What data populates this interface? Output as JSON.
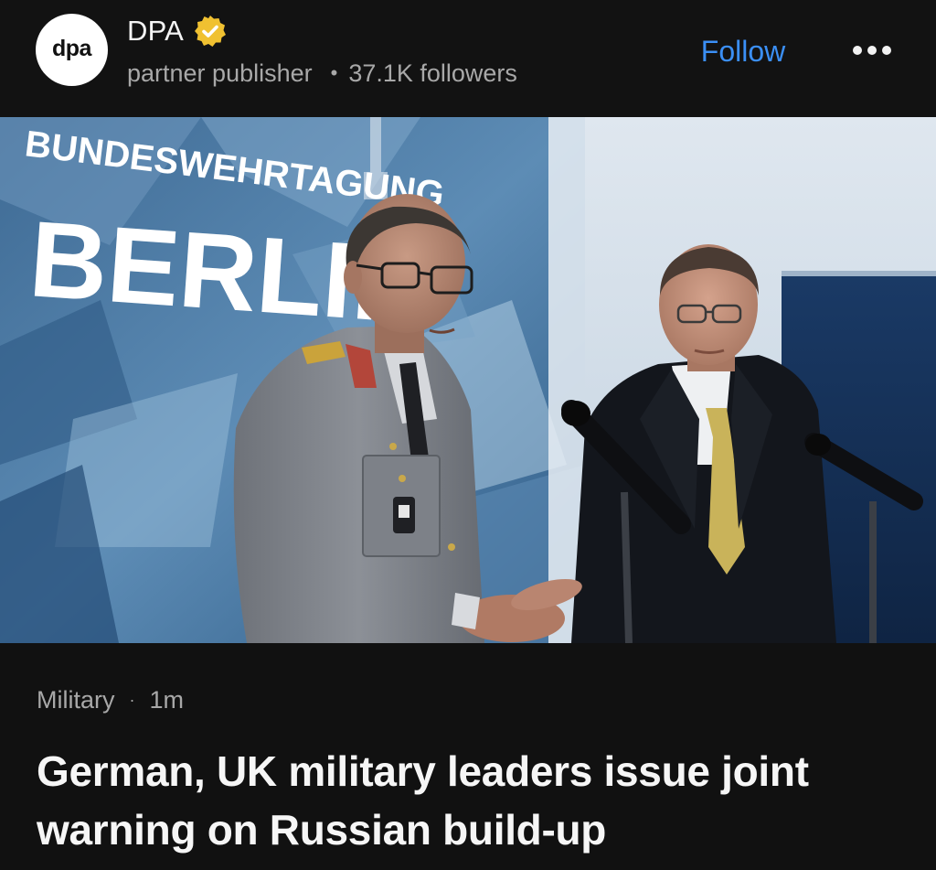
{
  "publisher": {
    "avatar_text": "dpa",
    "name": "DPA",
    "type_label": "partner publisher",
    "followers": "37.1K followers",
    "follow_label": "Follow",
    "more_icon": "more-horizontal-icon",
    "verified_icon": "verified-badge-icon"
  },
  "hero": {
    "backdrop_line1": "BUNDESWEHRTAGUNG",
    "backdrop_line2": "BERLIN"
  },
  "article": {
    "category": "Military",
    "separator": "·",
    "age": "1m",
    "headline": "German, UK military leaders issue joint warning on Russian build-up"
  },
  "colors": {
    "background": "#111111",
    "accent": "#3b8ff5",
    "verified": "#f0c131",
    "muted_text": "#a8a8a8",
    "primary_text": "#f6f6f6"
  }
}
